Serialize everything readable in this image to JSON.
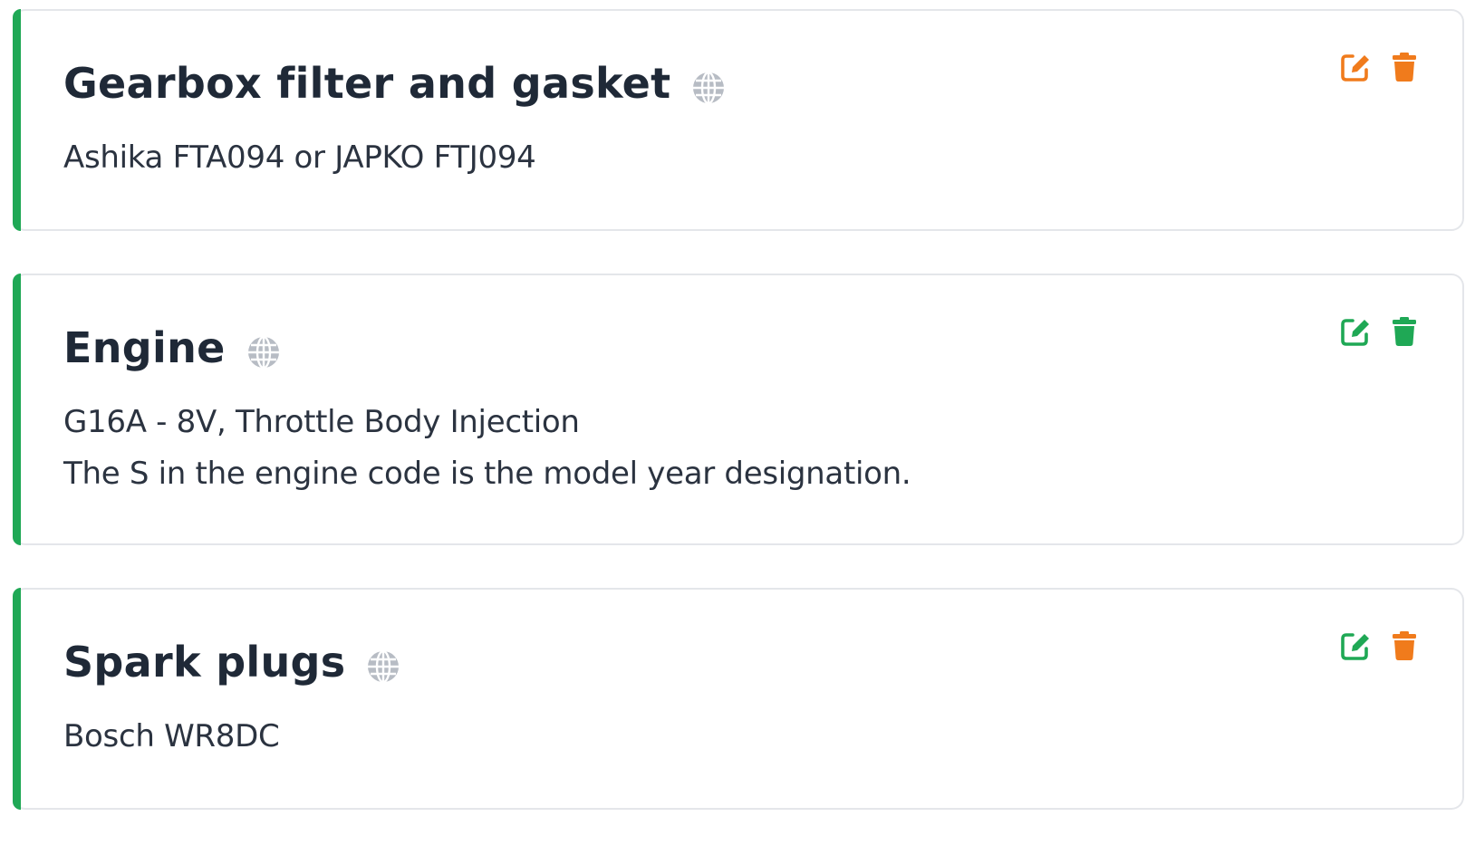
{
  "colors": {
    "accent_bar": "#1fa855",
    "edit_orange": "#f07b1c",
    "delete_orange": "#f07b1c",
    "edit_green": "#1fa855",
    "delete_green": "#1fa855",
    "globe_gray": "#b7bcc4"
  },
  "cards": [
    {
      "title": "Gearbox filter and gasket",
      "description_lines": [
        "Ashika FTA094 or JAPKO FTJ094"
      ],
      "edit_icon": "edit-icon",
      "edit_color": "#f07b1c",
      "delete_icon": "trash-icon",
      "delete_color": "#f07b1c",
      "public_icon": "globe-icon"
    },
    {
      "title": "Engine",
      "description_lines": [
        "G16A - 8V, Throttle Body Injection",
        "The S in the engine code is the model year designation."
      ],
      "edit_icon": "edit-icon",
      "edit_color": "#1fa855",
      "delete_icon": "trash-icon",
      "delete_color": "#1fa855",
      "public_icon": "globe-icon"
    },
    {
      "title": "Spark plugs",
      "description_lines": [
        "Bosch WR8DC"
      ],
      "edit_icon": "edit-icon",
      "edit_color": "#1fa855",
      "delete_icon": "trash-icon",
      "delete_color": "#f07b1c",
      "public_icon": "globe-icon"
    }
  ]
}
